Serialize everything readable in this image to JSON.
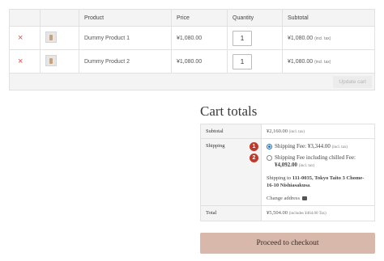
{
  "cart": {
    "headers": [
      "",
      "",
      "Product",
      "Price",
      "Quantity",
      "Subtotal"
    ],
    "rows": [
      {
        "remove": "×",
        "name": "Dummy Product 1",
        "price": "¥1,080.00",
        "qty": "1",
        "subtotal": "¥1,080.00",
        "incl": "(incl. tax)"
      },
      {
        "remove": "×",
        "name": "Dummy Product 2",
        "price": "¥1,080.00",
        "qty": "1",
        "subtotal": "¥1,080.00",
        "incl": "(incl. tax)"
      }
    ],
    "update_label": "Update cart"
  },
  "totals": {
    "title": "Cart totals",
    "subtotal_label": "Subtotal",
    "subtotal_value": "¥2,160.00",
    "subtotal_incl": "(incl. tax)",
    "shipping_label": "Shipping",
    "options": [
      {
        "badge": "1",
        "text": "Shipping Fee: ",
        "amount": "¥3,344.00",
        "incl": "(incl. tax)",
        "checked": true
      },
      {
        "badge": "2",
        "text": "Shipping Fee including chilled Fee: ",
        "amount": "¥4,092.00",
        "incl": "(incl. tax)",
        "checked": false
      }
    ],
    "ship_to_prefix": "Shipping to ",
    "ship_to_address": "111-0035, Tokyo Taito 3 Chome-16-10 Nishiasakusa",
    "ship_to_suffix": ".",
    "change_address": "Change address",
    "total_label": "Total",
    "total_value": "¥5,504.00",
    "total_incl": "(includes ¥464.00 Tax)"
  },
  "checkout_label": "Proceed to checkout",
  "colors": {
    "remove": "#d9534f",
    "badge": "#c0392b",
    "checkout_bg": "#d8b8aa",
    "radio": "#1e73be"
  },
  "icons": {
    "remove": "close-icon",
    "change_address": "truck-icon"
  }
}
